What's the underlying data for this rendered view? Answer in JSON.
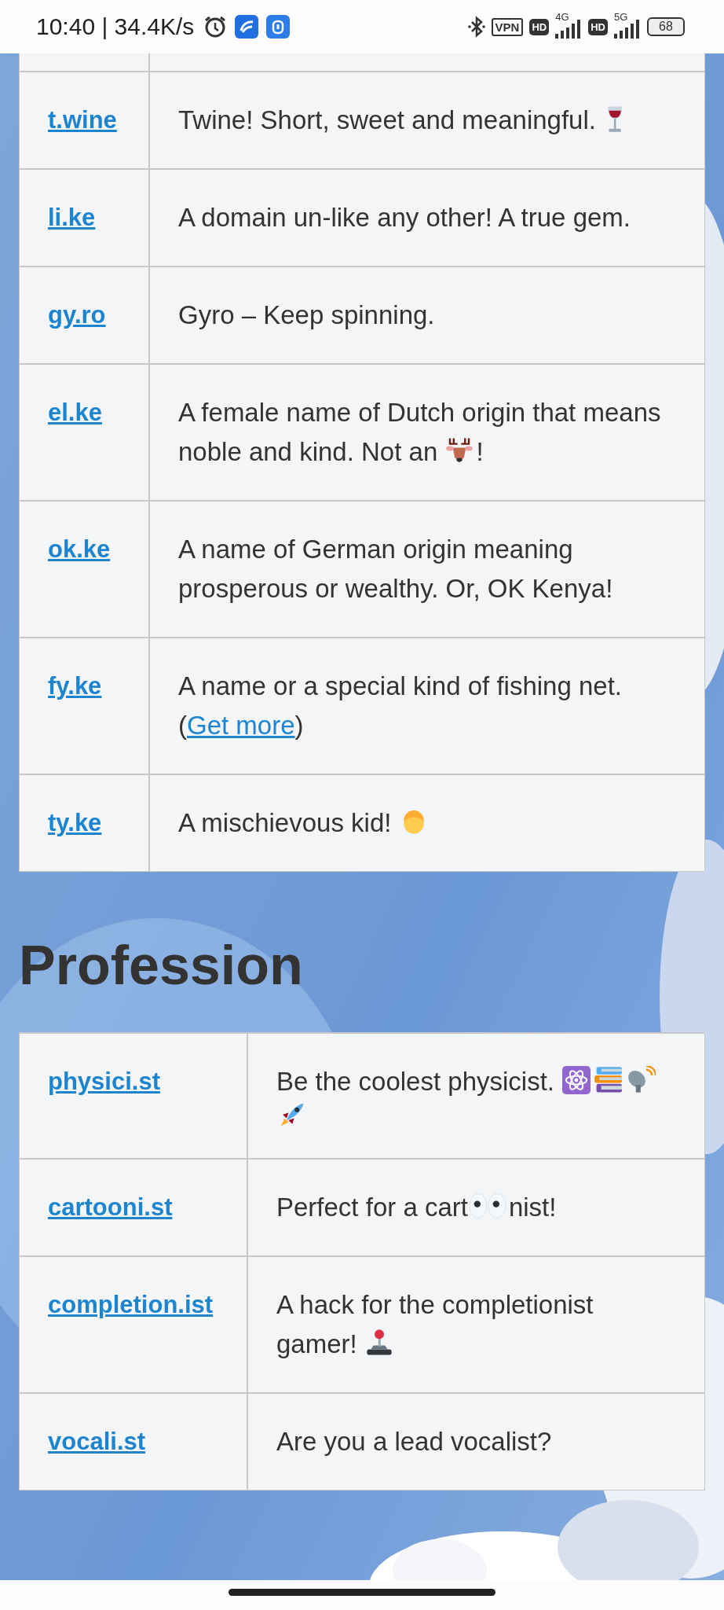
{
  "status_bar": {
    "time": "10:40 | 34.4K/s",
    "vpn": "VPN",
    "sim1": {
      "hd": "HD",
      "network": "4G"
    },
    "sim2": {
      "hd": "HD",
      "network": "5G"
    },
    "battery": "68"
  },
  "sections": [
    {
      "rows": [
        {
          "domain": "t.wine",
          "parts": [
            {
              "kind": "text",
              "text": "Twine! Short, sweet and meaningful. "
            },
            {
              "kind": "wine"
            }
          ]
        },
        {
          "domain": "li.ke",
          "parts": [
            {
              "kind": "text",
              "text": "A domain un-like any other! A true gem."
            }
          ]
        },
        {
          "domain": "gy.ro",
          "parts": [
            {
              "kind": "text",
              "text": "Gyro – Keep spinning."
            }
          ]
        },
        {
          "domain": "el.ke",
          "parts": [
            {
              "kind": "text",
              "text": "A female name of Dutch origin that means noble and kind. Not an "
            },
            {
              "kind": "deer"
            },
            {
              "kind": "text",
              "text": "!"
            }
          ]
        },
        {
          "domain": "ok.ke",
          "parts": [
            {
              "kind": "text",
              "text": "A name of German origin meaning prosperous or wealthy. Or, OK Kenya!"
            }
          ]
        },
        {
          "domain": "fy.ke",
          "parts": [
            {
              "kind": "text",
              "text": "A name or a special kind of fishing net. ("
            },
            {
              "kind": "link",
              "text": "Get more"
            },
            {
              "kind": "text",
              "text": ")"
            }
          ]
        },
        {
          "domain": "ty.ke",
          "parts": [
            {
              "kind": "text",
              "text": "A mischievous kid! "
            },
            {
              "kind": "child"
            }
          ]
        }
      ]
    },
    {
      "heading": "Profession",
      "rows": [
        {
          "domain": "physici.st",
          "parts": [
            {
              "kind": "text",
              "text": "Be the coolest physicist. "
            },
            {
              "kind": "atom"
            },
            {
              "kind": "books"
            },
            {
              "kind": "dish"
            },
            {
              "kind": "rocket"
            }
          ]
        },
        {
          "domain": "cartooni.st",
          "parts": [
            {
              "kind": "text",
              "text": "Perfect for a cart"
            },
            {
              "kind": "eyes"
            },
            {
              "kind": "text",
              "text": "nist!"
            }
          ]
        },
        {
          "domain": "completion.ist",
          "parts": [
            {
              "kind": "text",
              "text": "A hack for the completionist gamer! "
            },
            {
              "kind": "joystick"
            }
          ]
        },
        {
          "domain": "vocali.st",
          "parts": [
            {
              "kind": "text",
              "text": "Are you a lead vocalist?"
            }
          ]
        }
      ]
    }
  ]
}
